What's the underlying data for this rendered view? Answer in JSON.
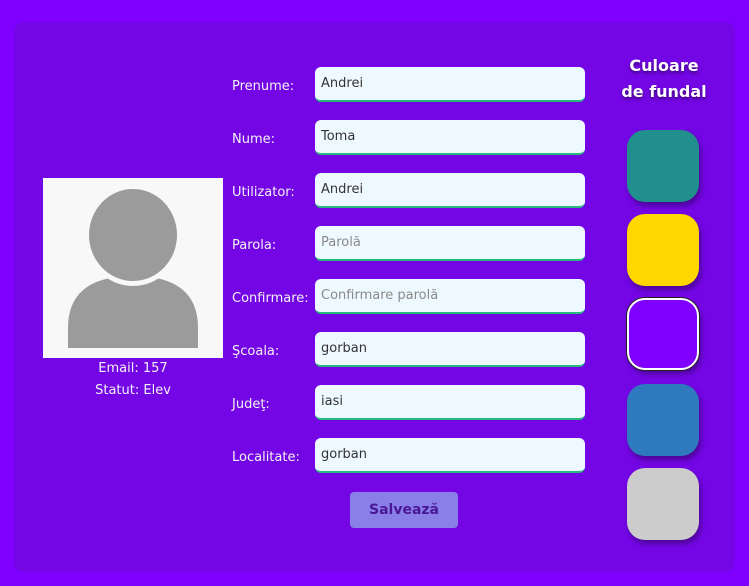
{
  "profile": {
    "email_text": "Email: 157",
    "statut_text": "Statut: Elev"
  },
  "form": {
    "prenume": {
      "label": "Prenume:",
      "value": "Andrei",
      "placeholder": ""
    },
    "nume": {
      "label": "Nume:",
      "value": "Toma",
      "placeholder": ""
    },
    "utilizator": {
      "label": "Utilizator:",
      "value": "Andrei",
      "placeholder": ""
    },
    "parola": {
      "label": "Parola:",
      "value": "",
      "placeholder": "Parolă"
    },
    "confirmare": {
      "label": "Confirmare:",
      "value": "",
      "placeholder": "Confirmare parolă"
    },
    "scoala": {
      "label": "Şcoala:",
      "value": "gorban",
      "placeholder": ""
    },
    "judet": {
      "label": "Judeţ:",
      "value": "iasi",
      "placeholder": ""
    },
    "localitate": {
      "label": "Localitate:",
      "value": "gorban",
      "placeholder": ""
    },
    "save_label": "Salvează"
  },
  "colors": {
    "title_line1": "Culoare",
    "title_line2": "de fundal",
    "swatches": [
      {
        "name": "teal",
        "hex": "#21908d",
        "selected": false
      },
      {
        "name": "yellow",
        "hex": "#ffd700",
        "selected": false
      },
      {
        "name": "violet",
        "hex": "#7f00ff",
        "selected": true
      },
      {
        "name": "blue",
        "hex": "#2f7abf",
        "selected": false
      },
      {
        "name": "light-gray",
        "hex": "#cccccc",
        "selected": false
      }
    ]
  },
  "theme": {
    "page_background": "#7f00ff",
    "panel_background": "#7406e6",
    "input_background": "#eef8ff",
    "input_border_accent": "#28b87f",
    "button_background": "#8a7fe6",
    "button_text": "#4a1896"
  }
}
